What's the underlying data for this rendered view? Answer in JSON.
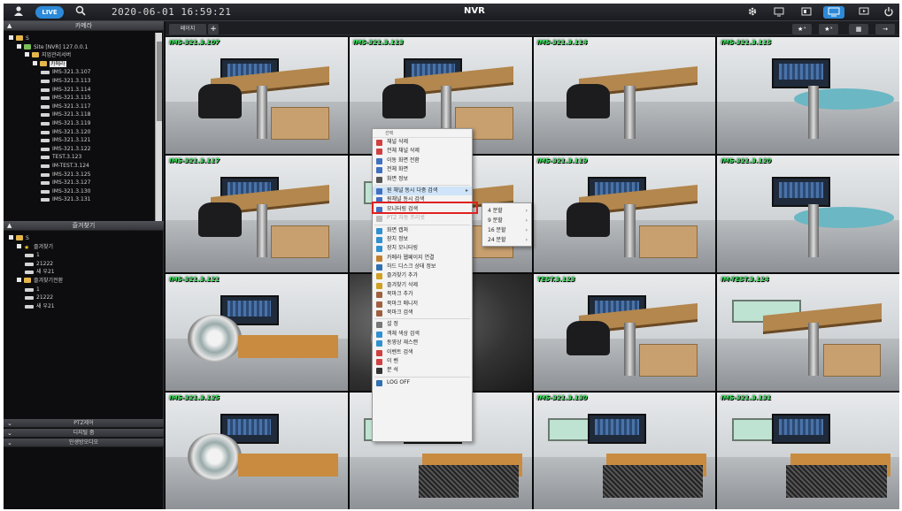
{
  "topbar": {
    "live_label": "LIVE",
    "clock": "2020-06-01 16:59:21",
    "title": "NVR",
    "icons_left": [
      "user-icon",
      "search-icon"
    ],
    "icons_right": [
      "gear-icon",
      "monitor-split-icon",
      "layout-icon",
      "live-view-icon",
      "playback-icon",
      "power-icon"
    ]
  },
  "left_panel": {
    "device_header": "카메라",
    "device_tree": [
      {
        "label": "S",
        "level": 0,
        "icon": "home"
      },
      {
        "label": "Site [NVR] 127.0.0.1",
        "level": 1,
        "icon": "pc"
      },
      {
        "label": "지업관리서버",
        "level": 2,
        "icon": "folder"
      },
      {
        "label": "카메라",
        "level": 3,
        "icon": "folder",
        "selected": true
      },
      {
        "label": "IMS-321.3.107",
        "level": 4,
        "icon": "cam"
      },
      {
        "label": "IMS-321.3.113",
        "level": 4,
        "icon": "cam"
      },
      {
        "label": "IMS-321.3.114",
        "level": 4,
        "icon": "cam"
      },
      {
        "label": "IMS-321.3.115",
        "level": 4,
        "icon": "cam"
      },
      {
        "label": "IMS-321.3.117",
        "level": 4,
        "icon": "cam"
      },
      {
        "label": "IMS-321.3.118",
        "level": 4,
        "icon": "cam"
      },
      {
        "label": "IMS-321.3.119",
        "level": 4,
        "icon": "cam"
      },
      {
        "label": "IMS-321.3.120",
        "level": 4,
        "icon": "cam"
      },
      {
        "label": "IMS-321.3.121",
        "level": 4,
        "icon": "cam"
      },
      {
        "label": "IMS-321.3.122",
        "level": 4,
        "icon": "cam"
      },
      {
        "label": "TEST.3.123",
        "level": 4,
        "icon": "cam"
      },
      {
        "label": "IM-TEST.3.124",
        "level": 4,
        "icon": "cam"
      },
      {
        "label": "IMS-321.3.125",
        "level": 4,
        "icon": "cam"
      },
      {
        "label": "IMS-321.3.127",
        "level": 4,
        "icon": "cam"
      },
      {
        "label": "IMS-321.3.130",
        "level": 4,
        "icon": "cam"
      },
      {
        "label": "IMS-321.3.131",
        "level": 4,
        "icon": "cam"
      }
    ],
    "favorites_header": "즐겨찾기",
    "favorites_tree": [
      {
        "label": "S",
        "level": 0,
        "icon": "home"
      },
      {
        "label": "즐겨찾기",
        "level": 1,
        "icon": "star"
      },
      {
        "label": "1",
        "level": 2,
        "icon": "cam"
      },
      {
        "label": "21222",
        "level": 2,
        "icon": "cam"
      },
      {
        "label": "새 우21",
        "level": 2,
        "icon": "cam"
      },
      {
        "label": "즐겨찾기전환",
        "level": 1,
        "icon": "folder"
      },
      {
        "label": "1",
        "level": 2,
        "icon": "cam"
      },
      {
        "label": "21222",
        "level": 2,
        "icon": "cam"
      },
      {
        "label": "새 우21",
        "level": 2,
        "icon": "cam"
      }
    ],
    "accordions": [
      "PTZ제어",
      "디지털 줌",
      "인생방오디오"
    ]
  },
  "main": {
    "tab_label": "페이지",
    "tab_add": "+",
    "toolbar": [
      "★⁺",
      "★ˣ",
      "▦",
      "→"
    ]
  },
  "tiles": [
    {
      "label": "IMS-321.3.107",
      "scene": "desk",
      "selected": false
    },
    {
      "label": "IMS-321.3.113",
      "scene": "desk",
      "selected": true
    },
    {
      "label": "IMS-321.3.114",
      "scene": "chair",
      "selected": false
    },
    {
      "label": "IMS-321.3.115",
      "scene": "round",
      "selected": false
    },
    {
      "label": "IMS-321.3.117",
      "scene": "desk",
      "selected": false
    },
    {
      "label": "",
      "scene": "board",
      "selected": false
    },
    {
      "label": "IMS-321.3.119",
      "scene": "desk",
      "selected": false
    },
    {
      "label": "IMS-321.3.120",
      "scene": "round",
      "selected": false
    },
    {
      "label": "IMS-321.3.121",
      "scene": "fan",
      "selected": false
    },
    {
      "label": "",
      "scene": "dark",
      "selected": false
    },
    {
      "label": "TEST.3.123",
      "scene": "desk",
      "selected": false
    },
    {
      "label": "IM-TEST.3.124",
      "scene": "board",
      "selected": false
    },
    {
      "label": "IMS-321.3.125",
      "scene": "fan",
      "selected": false
    },
    {
      "label": "",
      "scene": "cables",
      "selected": false
    },
    {
      "label": "IMS-321.3.130",
      "scene": "cables",
      "selected": false
    },
    {
      "label": "IMS-321.3.131",
      "scene": "cables",
      "selected": false
    }
  ],
  "context_menu": {
    "header": "선택",
    "items": [
      {
        "label": "채널 삭제",
        "color": "#d04040"
      },
      {
        "label": "전체 채널 삭제",
        "color": "#d04040"
      },
      {
        "label": "이동 화면 전환",
        "color": "#4070c0"
      },
      {
        "label": "전체 화면",
        "color": "#4070c0"
      },
      {
        "label": "화면 정보",
        "color": "#555555"
      },
      {
        "sep": true
      },
      {
        "label": "원 채널 동시 다중 검색",
        "color": "#4070c0",
        "arrow": "▸",
        "highlight": true
      },
      {
        "label": "원채널 동시 검색",
        "color": "#4070c0"
      },
      {
        "label": "모니터링 검색",
        "color": "#4070c0"
      },
      {
        "label": "PTZ 자동 프리셋",
        "color": "#bbbbbb",
        "disabled": true
      },
      {
        "sep": true
      },
      {
        "label": "화면 캡쳐",
        "color": "#3090d0"
      },
      {
        "label": "장치 정보",
        "color": "#3090d0"
      },
      {
        "label": "장치 모니터링",
        "color": "#3090d0"
      },
      {
        "label": "카메라 웹페이지 연결",
        "color": "#c08030"
      },
      {
        "label": "하드 디스크 상태 정보",
        "color": "#3070b0"
      },
      {
        "label": "즐겨찾기 추가",
        "color": "#d0a020"
      },
      {
        "label": "즐겨찾기 삭제",
        "color": "#d0a020"
      },
      {
        "label": "북마크 추가",
        "color": "#a06040"
      },
      {
        "label": "북마크 매니저",
        "color": "#a06040"
      },
      {
        "label": "북마크 검색",
        "color": "#a06040"
      },
      {
        "sep": true
      },
      {
        "label": "설 정",
        "color": "#777777"
      },
      {
        "label": "객체 색상 검색",
        "color": "#3090d0"
      },
      {
        "label": "동영상 재스캔",
        "color": "#3090d0"
      },
      {
        "label": "이벤트 검색",
        "color": "#d04040"
      },
      {
        "label": "이 벤",
        "color": "#d04040"
      },
      {
        "label": "분 석",
        "color": "#333333"
      },
      {
        "sep": true
      },
      {
        "label": "LOG OFF",
        "color": "#3070b0"
      }
    ]
  },
  "submenu": {
    "items": [
      "4 분할",
      "9 분할",
      "16 분할",
      "24 분할"
    ]
  }
}
